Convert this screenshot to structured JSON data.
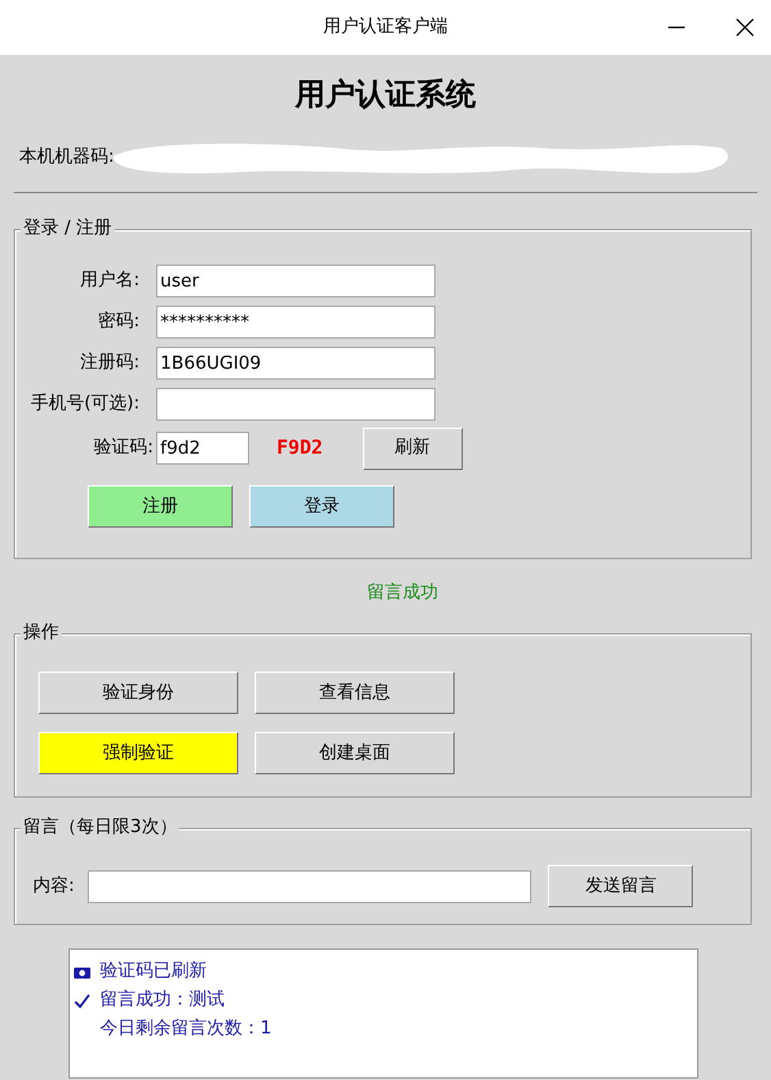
{
  "window": {
    "title": "用户认证客户端"
  },
  "heading": "用户认证系统",
  "machine_code": {
    "label": "本机机器码:",
    "redacted": true
  },
  "login": {
    "legend": "登录 / 注册",
    "fields": [
      {
        "label": "用户名:",
        "value": "user"
      },
      {
        "label": "密码:",
        "value": "**********"
      },
      {
        "label": "注册码:",
        "value": "1B66UGI09"
      },
      {
        "label": "手机号(可选):"
      }
    ],
    "captcha": {
      "label": "验证码:",
      "value": "f9d2",
      "code": "F9D2",
      "refresh": "刷新"
    },
    "buttons": [
      {
        "label": "注册",
        "color": "#90ee90"
      },
      {
        "label": "登录",
        "color": "#add8e6"
      }
    ]
  },
  "status": "留言成功",
  "operations": {
    "legend": "操作",
    "buttons": [
      {
        "label": "验证身份",
        "color": "#d9d9d9"
      },
      {
        "label": "查看信息",
        "color": "#d9d9d9"
      },
      {
        "label": "强制验证",
        "color": "#ffff00"
      },
      {
        "label": "创建桌面",
        "color": "#d9d9d9"
      }
    ]
  },
  "message": {
    "legend": "留言（每日限3次）",
    "label": "内容:",
    "send": "发送留言"
  },
  "log": [
    {
      "kind": "camera",
      "text": "验证码已刷新"
    },
    {
      "kind": "check",
      "text": "留言成功：测试"
    },
    {
      "kind": "plain",
      "text": "今日剩余留言次数：1"
    }
  ]
}
